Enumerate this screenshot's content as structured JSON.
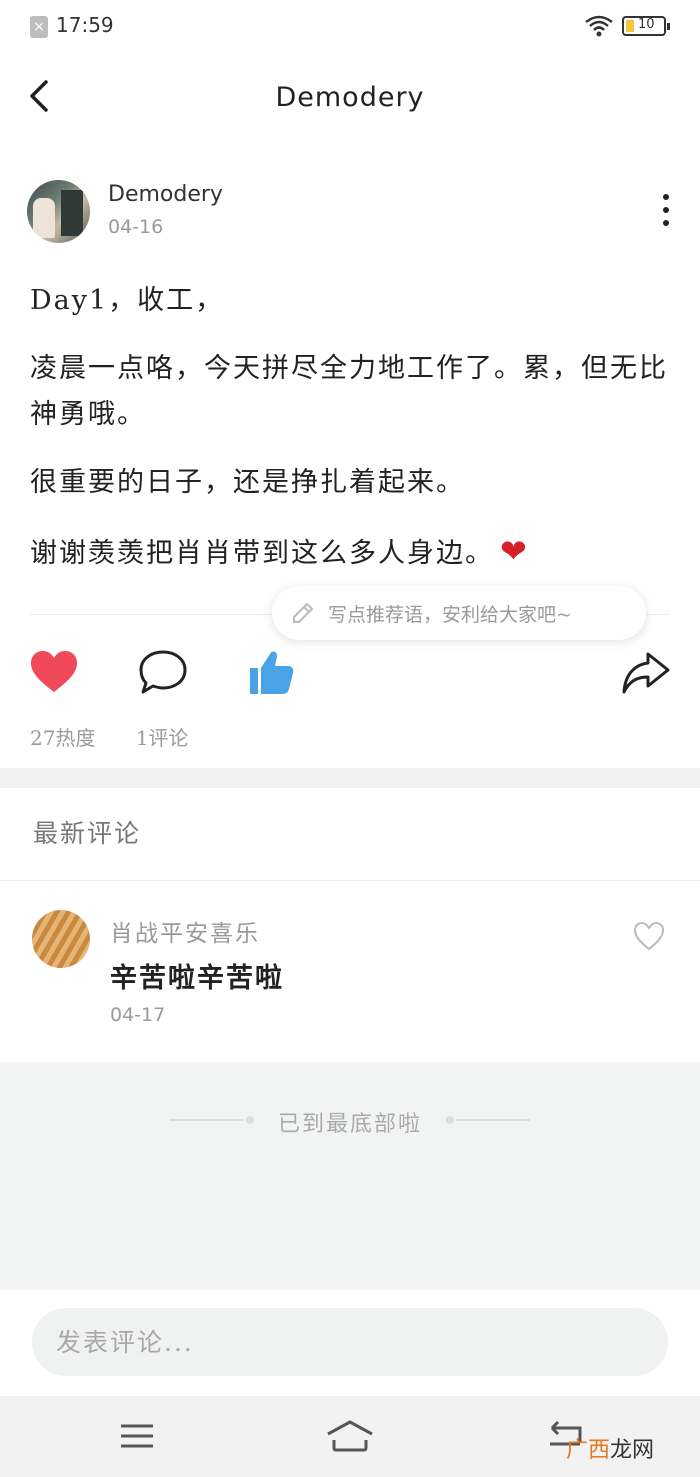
{
  "status_bar": {
    "time": "17:59",
    "battery": "10"
  },
  "header": {
    "title": "Demodery"
  },
  "author": {
    "name": "Demodery",
    "date": "04-16"
  },
  "post": {
    "paragraphs": [
      "Day1，收工，",
      "凌晨一点咯，今天拼尽全力地工作了。累，但无比神勇哦。",
      "很重要的日子，还是挣扎着起来。",
      "谢谢羡羡把肖肖带到这么多人身边。"
    ],
    "emoji": "❤"
  },
  "recommend": {
    "text": "写点推荐语，安利给大家吧~"
  },
  "stats": {
    "heat": "27热度",
    "comments": "1评论"
  },
  "latest_comments": {
    "title": "最新评论",
    "items": [
      {
        "user": "肖战平安喜乐",
        "text": "辛苦啦辛苦啦",
        "date": "04-17"
      }
    ]
  },
  "end_text": "已到最底部啦",
  "comment_input": {
    "placeholder": "发表评论..."
  },
  "watermark": {
    "part1": "广西",
    "part2": "龙网"
  },
  "colors": {
    "like_red": "#f04a5a",
    "thumb_blue": "#4aa3e6",
    "bg_gray": "#f2f3f3"
  },
  "icons": [
    "back-icon",
    "more-icon",
    "pencil-icon",
    "heart-icon",
    "chat-bubble-icon",
    "thumbs-up-icon",
    "share-icon",
    "like-outline-icon",
    "menu-icon",
    "home-icon",
    "return-icon"
  ]
}
